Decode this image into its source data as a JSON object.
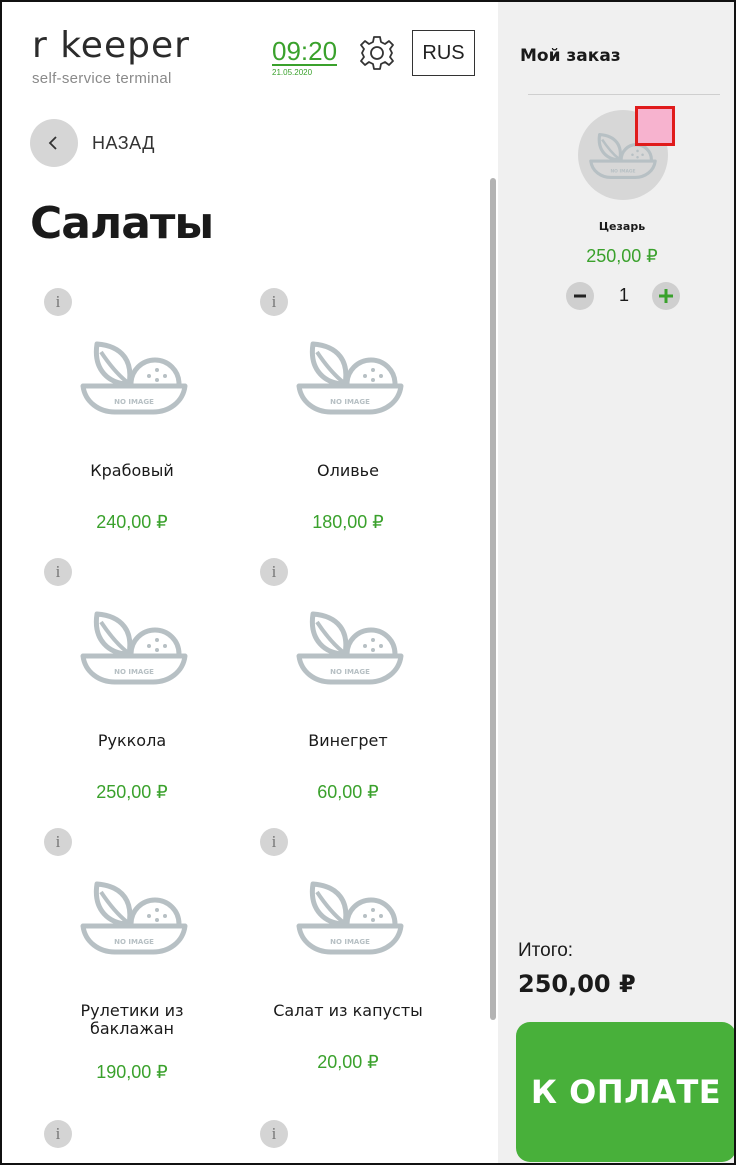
{
  "header": {
    "logo_main": "r  keeper",
    "logo_sub": "self-service terminal",
    "time": "09:20",
    "date": "21.05.2020",
    "language": "RUS",
    "settings_icon": "gear-icon"
  },
  "nav": {
    "back_label": "НАЗАД",
    "back_icon": "chevron-left-icon"
  },
  "category": {
    "title": "Салаты"
  },
  "products": [
    {
      "name": "Крабовый",
      "price": "240,00 ₽",
      "info": "i",
      "image": "no-image-placeholder"
    },
    {
      "name": "Оливье",
      "price": "180,00 ₽",
      "info": "i",
      "image": "no-image-placeholder"
    },
    {
      "name": "Руккола",
      "price": "250,00 ₽",
      "info": "i",
      "image": "no-image-placeholder"
    },
    {
      "name": "Винегрет",
      "price": "60,00 ₽",
      "info": "i",
      "image": "no-image-placeholder"
    },
    {
      "name": "Рулетики из баклажан",
      "price": "190,00 ₽",
      "info": "i",
      "image": "no-image-placeholder"
    },
    {
      "name": "Салат из капусты",
      "price": "20,00 ₽",
      "info": "i",
      "image": "no-image-placeholder"
    },
    {
      "info": "i"
    },
    {
      "info": "i"
    }
  ],
  "placeholder_image_text": "NO IMAGE",
  "order": {
    "title": "Мой заказ",
    "items": [
      {
        "name": "Цезарь",
        "price": "250,00 ₽",
        "quantity": "1"
      }
    ],
    "total_label": "Итого:",
    "total_value": "250,00 ₽",
    "pay_label": "К ОПЛАТЕ"
  },
  "colors": {
    "accent_green": "#3aa12c",
    "pay_button": "#48b03a",
    "sidebar_bg": "#f0f0f0",
    "placeholder_gray": "#b7c0c4",
    "marker_border": "#e01b1b",
    "marker_fill": "#f7b3cf"
  }
}
